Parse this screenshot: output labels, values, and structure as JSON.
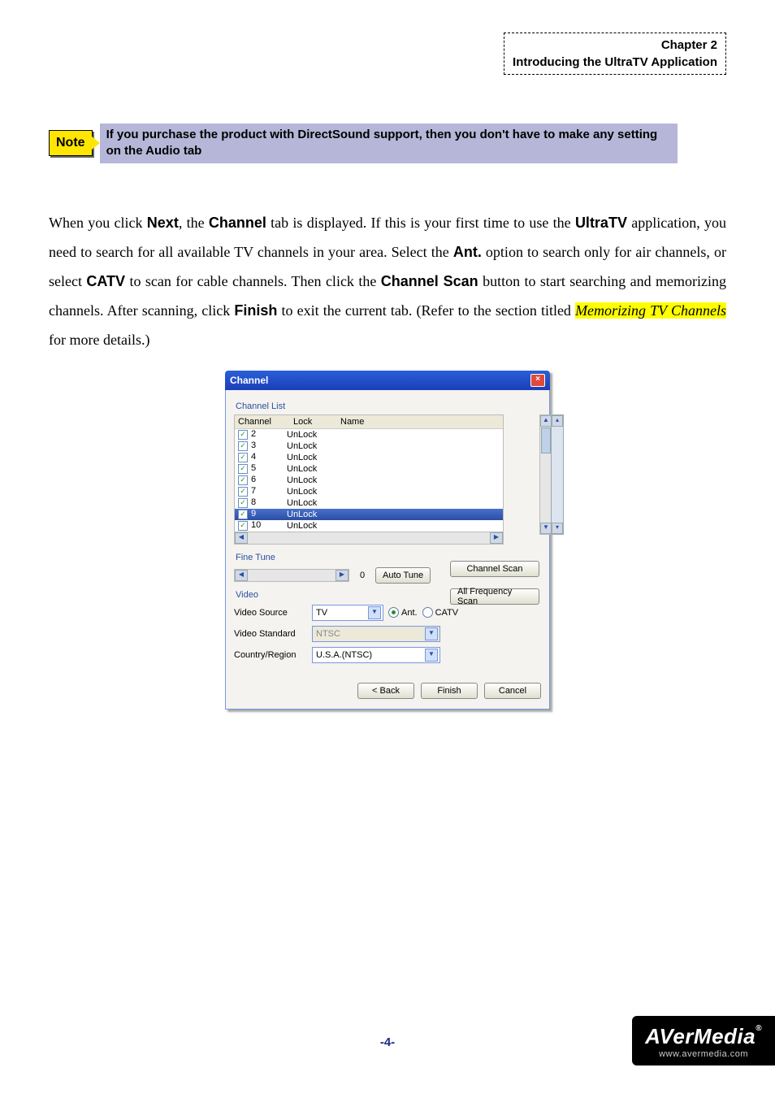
{
  "header": {
    "chapter": "Chapter 2",
    "subtitle": "Introducing the UltraTV Application"
  },
  "note": {
    "badge": "Note",
    "text": "If you purchase the product with DirectSound support, then you don't have to make any setting on the Audio tab"
  },
  "body": {
    "p1a": "When you click ",
    "p1b": "Next",
    "p1c": ", the ",
    "p1d": "Channel",
    "p1e": " tab is displayed. If this is your first time to use the ",
    "p1f": "UltraTV",
    "p1g": " application, you need to search for all available TV channels in your area. Select the ",
    "p1h": "Ant.",
    "p1i": " option to search only for air channels, or select ",
    "p1j": "CATV",
    "p1k": " to scan for cable channels. Then click the ",
    "p1l": "Channel Scan",
    "p1m": " button to start searching and memorizing channels. After scanning, click ",
    "p1n": "Finish",
    "p1o": " to exit the current tab. (Refer to the section titled ",
    "p1p": "Memorizing TV Channels",
    "p1q": " for more details.)"
  },
  "dialog": {
    "title": "Channel",
    "channel_list_label": "Channel List",
    "head_channel": "Channel",
    "head_lock": "Lock",
    "head_name": "Name",
    "rows": [
      {
        "num": "2",
        "lock": "UnLock",
        "sel": false
      },
      {
        "num": "3",
        "lock": "UnLock",
        "sel": false
      },
      {
        "num": "4",
        "lock": "UnLock",
        "sel": false
      },
      {
        "num": "5",
        "lock": "UnLock",
        "sel": false
      },
      {
        "num": "6",
        "lock": "UnLock",
        "sel": false
      },
      {
        "num": "7",
        "lock": "UnLock",
        "sel": false
      },
      {
        "num": "8",
        "lock": "UnLock",
        "sel": false
      },
      {
        "num": "9",
        "lock": "UnLock",
        "sel": true
      },
      {
        "num": "10",
        "lock": "UnLock",
        "sel": false
      }
    ],
    "fine_tune_label": "Fine Tune",
    "fine_value": "0",
    "auto_tune": "Auto Tune",
    "channel_scan": "Channel Scan",
    "all_freq_scan": "All Frequency Scan",
    "video_label": "Video",
    "video_source_label": "Video Source",
    "video_source_value": "TV",
    "ant_label": "Ant.",
    "catv_label": "CATV",
    "video_standard_label": "Video Standard",
    "video_standard_value": "NTSC",
    "country_label": "Country/Region",
    "country_value": "U.S.A.(NTSC)",
    "back": "< Back",
    "finish": "Finish",
    "cancel": "Cancel"
  },
  "footer": {
    "page": "-4-",
    "brand": "AVerMedia",
    "url": "www.avermedia.com"
  }
}
